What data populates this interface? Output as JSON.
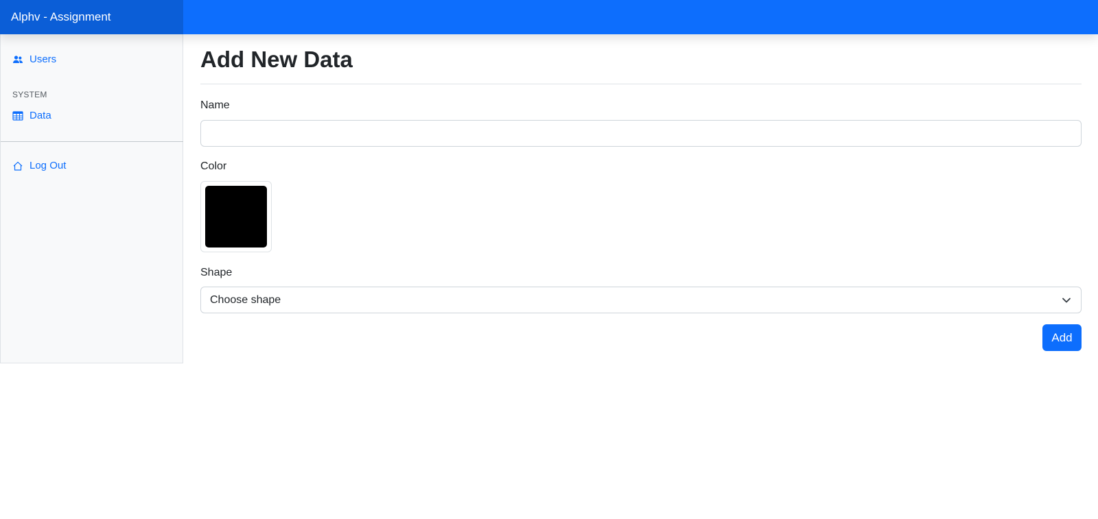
{
  "app": {
    "title": "Alphv - Assignment"
  },
  "sidebar": {
    "items": [
      {
        "label": "Users",
        "icon": "users-icon"
      },
      {
        "label": "Data",
        "icon": "table-icon"
      },
      {
        "label": "Log Out",
        "icon": "home-icon"
      }
    ],
    "section_heading": "SYSTEM"
  },
  "page": {
    "title": "Add New Data"
  },
  "form": {
    "name_label": "Name",
    "name_value": "",
    "color_label": "Color",
    "color_value": "#000000",
    "shape_label": "Shape",
    "shape_selected": "Choose shape",
    "submit_label": "Add"
  },
  "colors": {
    "primary": "#0d6efd",
    "brand_bg": "#0b5ed7",
    "sidebar_bg": "#f8f9fa"
  }
}
